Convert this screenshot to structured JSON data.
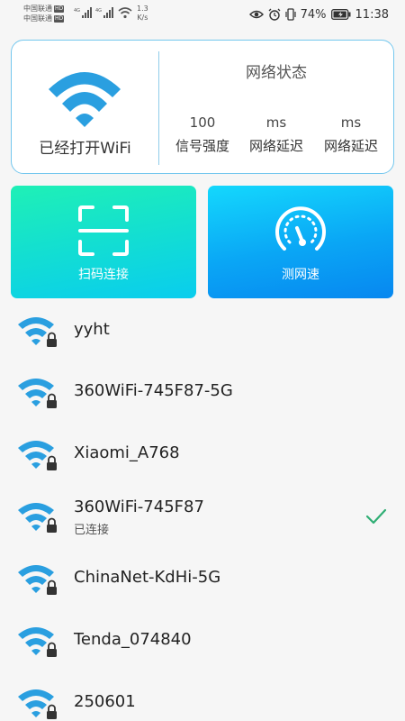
{
  "status_bar": {
    "carrier_1": "中国联通",
    "carrier_2": "中国联通",
    "hd_badge": "HD",
    "net_gen": "4G",
    "speed_value": "1.3",
    "speed_unit": "K/s",
    "battery": "74%",
    "time": "11:38",
    "icons": [
      "signal-icon",
      "wifi-icon",
      "eye-icon",
      "alarm-icon",
      "vibrate-icon",
      "battery-icon"
    ]
  },
  "overview": {
    "wifi_state": "已经打开WiFi",
    "network_title": "网络状态",
    "metrics": [
      {
        "value": "100",
        "label": "信号强度"
      },
      {
        "value": "ms",
        "label": "网络延迟"
      },
      {
        "value": "ms",
        "label": "网络延迟"
      }
    ]
  },
  "actions": {
    "scan_label": "扫码连接",
    "speed_label": "测网速"
  },
  "wifi_list": [
    {
      "name": "yyht",
      "status": "",
      "connected": false,
      "locked": true
    },
    {
      "name": "360WiFi-745F87-5G",
      "status": "",
      "connected": false,
      "locked": true
    },
    {
      "name": "Xiaomi_A768",
      "status": "",
      "connected": false,
      "locked": true
    },
    {
      "name": "360WiFi-745F87",
      "status": "已连接",
      "connected": true,
      "locked": true
    },
    {
      "name": "ChinaNet-KdHi-5G",
      "status": "",
      "connected": false,
      "locked": true
    },
    {
      "name": "Tenda_074840",
      "status": "",
      "connected": false,
      "locked": true
    },
    {
      "name": "250601",
      "status": "",
      "connected": false,
      "locked": true
    }
  ],
  "colors": {
    "wifi_icon": "#2a9fe0",
    "card_border": "#74c7ee",
    "check": "#2fae74",
    "scan_tile_from": "#1ff0b6",
    "scan_tile_to": "#09cdee",
    "speed_tile_from": "#14d8fd",
    "speed_tile_to": "#0787f0"
  }
}
